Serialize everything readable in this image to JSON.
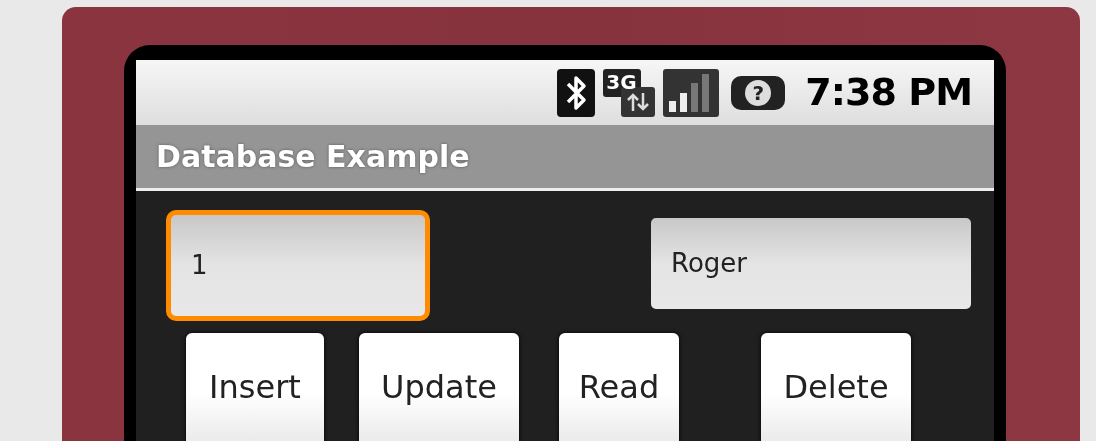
{
  "status_bar": {
    "network_type": "3G",
    "battery_glyph": "?",
    "time": "7:38 PM"
  },
  "app_bar": {
    "title": "Database Example"
  },
  "fields": [
    {
      "value": "1",
      "focused": true
    },
    {
      "value": "Roger",
      "focused": false
    }
  ],
  "buttons": [
    "Insert",
    "Update",
    "Read",
    "Delete"
  ]
}
